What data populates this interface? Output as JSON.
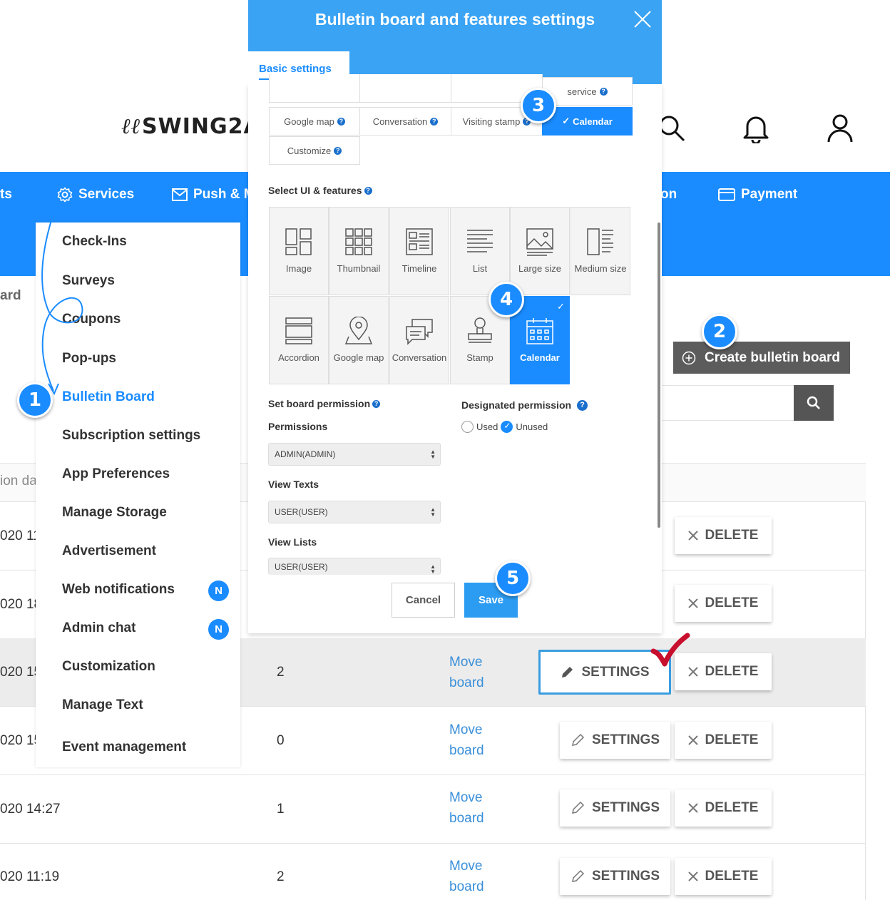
{
  "header": {
    "logo_text": "SWING2A",
    "logo_mark": "ℓℓ",
    "icons": [
      "search-icon",
      "bell-icon",
      "user-icon"
    ]
  },
  "nav": {
    "items": [
      {
        "label": "ts"
      },
      {
        "label": "Services",
        "icon": "gear-icon"
      },
      {
        "label": "Push & M",
        "icon": "mail-icon"
      },
      {
        "label": "on"
      },
      {
        "label": "Payment",
        "icon": "card-icon"
      }
    ]
  },
  "breadcrumb": "ard",
  "services_menu": [
    {
      "label": "Check-Ins"
    },
    {
      "label": "Surveys"
    },
    {
      "label": "Coupons"
    },
    {
      "label": "Pop-ups"
    },
    {
      "label": "Bulletin Board",
      "active": true
    },
    {
      "label": "Subscription settings"
    },
    {
      "label": "App Preferences"
    },
    {
      "label": "Manage Storage"
    },
    {
      "label": "Advertisement"
    },
    {
      "label": "Web notifications",
      "badge": "N"
    },
    {
      "label": "Admin chat",
      "badge": "N"
    },
    {
      "label": "Customization"
    },
    {
      "label": "Manage Text"
    },
    {
      "label": "Event management"
    }
  ],
  "toolbar": {
    "create_label": "Create bulletin board",
    "search_placeholder": ""
  },
  "table": {
    "header_label": "ion da",
    "move_label_1": "Move",
    "move_label_2": "board",
    "settings_label": "SETTINGS",
    "delete_label": "DELETE",
    "rows": [
      {
        "date": "020 11",
        "count": ""
      },
      {
        "date": "020 18",
        "count": ""
      },
      {
        "date": "020 15",
        "count": "2",
        "highlighted": true
      },
      {
        "date": "020 15",
        "count": "0"
      },
      {
        "date": "020 14:27",
        "count": "1"
      },
      {
        "date": "020 11:19",
        "count": "2"
      }
    ]
  },
  "modal": {
    "title": "Bulletin board and features settings",
    "tab_label": "Basic settings",
    "features": [
      {
        "label": "service",
        "help": true
      },
      {
        "label": "Google map",
        "help": true
      },
      {
        "label": "Conversation",
        "help": true
      },
      {
        "label": "Visiting stamp",
        "help": true
      },
      {
        "label": "Calendar",
        "selected": true
      },
      {
        "label": "Customize",
        "help": true
      }
    ],
    "select_ui_label": "Select UI & features",
    "ui_tiles": [
      {
        "label": "Image",
        "icon": "image-layout-icon"
      },
      {
        "label": "Thumbnail",
        "icon": "thumbnail-grid-icon"
      },
      {
        "label": "Timeline",
        "icon": "timeline-icon"
      },
      {
        "label": "List",
        "icon": "list-icon"
      },
      {
        "label": "Large size",
        "icon": "large-image-icon"
      },
      {
        "label": "Medium size",
        "icon": "medium-image-icon"
      },
      {
        "label": "Accordion",
        "icon": "accordion-icon"
      },
      {
        "label": "Google map",
        "icon": "map-pin-icon"
      },
      {
        "label": "Conversation",
        "icon": "chat-bubbles-icon"
      },
      {
        "label": "Stamp",
        "icon": "stamp-icon"
      },
      {
        "label": "Calendar",
        "icon": "calendar-icon",
        "selected": true
      }
    ],
    "board_permission_label": "Set board permission",
    "permissions_label": "Permissions",
    "permissions_value": "ADMIN(ADMIN)",
    "view_texts_label": "View Texts",
    "view_texts_value": "USER(USER)",
    "view_lists_label": "View Lists",
    "view_lists_value": "USER(USER)",
    "designated_label": "Designated permission",
    "radio_used": "Used",
    "radio_unused": "Unused",
    "radio_selected": "Unused",
    "cancel_label": "Cancel",
    "save_label": "Save"
  },
  "callouts": [
    "1",
    "2",
    "3",
    "4",
    "5"
  ],
  "colors": {
    "brand_blue": "#1a8cff",
    "modal_header": "#3aa3f4",
    "annotation_check": "#c8102e"
  }
}
